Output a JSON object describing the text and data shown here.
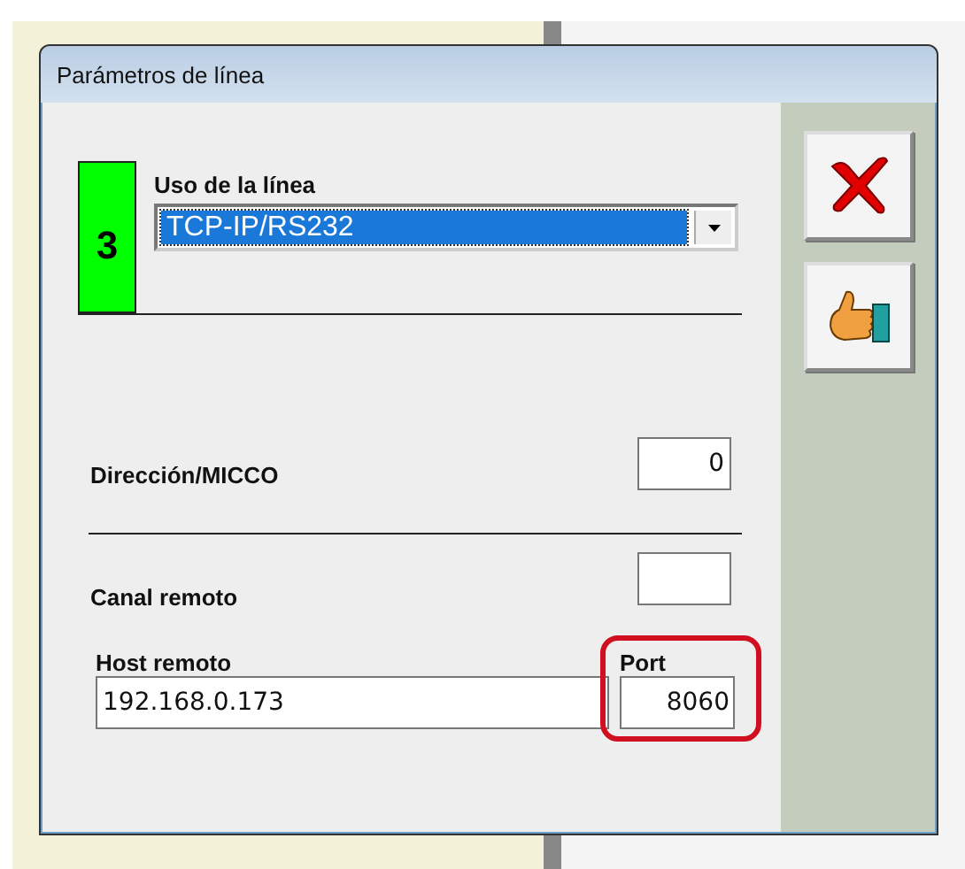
{
  "window": {
    "title": "Parámetros de línea"
  },
  "line_badge": {
    "text": "3"
  },
  "usage": {
    "label": "Uso de la línea",
    "value": "TCP-IP/RS232",
    "highlighted": true
  },
  "address": {
    "label": "Dirección/MICCO",
    "value": "0"
  },
  "remote_channel": {
    "label": "Canal remoto"
  },
  "remote_host": {
    "label": "Host remoto",
    "value": "192.168.0.173"
  },
  "port": {
    "label": "Port",
    "value": "8060",
    "highlighted": true
  },
  "buttons": [
    {
      "kind": "cancel"
    },
    {
      "kind": "ok"
    }
  ]
}
